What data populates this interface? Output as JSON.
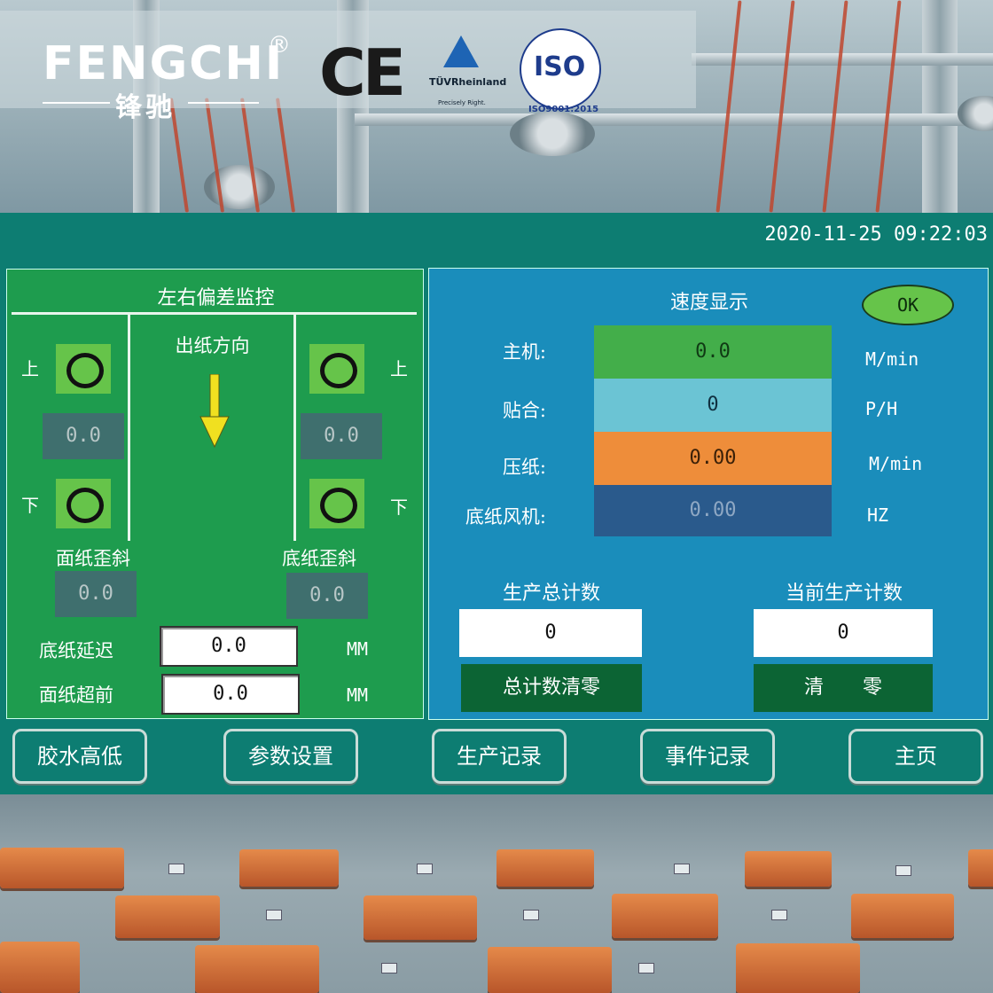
{
  "brand": {
    "name_en": "FENGCHI",
    "registered": "®",
    "name_cn": "锋驰",
    "ce": "CE",
    "tuv_name": "TÜVRheinland",
    "tuv_tagline": "Precisely Right.",
    "iso_mark": "ISO",
    "iso_standard": "ISO9001:2015"
  },
  "header": {
    "datetime": "2020-11-25 09:22:03"
  },
  "deviation_panel": {
    "title": "左右偏差监控",
    "direction_label": "出纸方向",
    "left": {
      "upper_label": "上",
      "upper_value": "0.0",
      "lower_label": "下"
    },
    "right": {
      "upper_label": "上",
      "upper_value": "0.0",
      "lower_label": "下"
    },
    "face_skew_label": "面纸歪斜",
    "face_skew_value": "0.0",
    "base_skew_label": "底纸歪斜",
    "base_skew_value": "0.0",
    "base_delay_label": "底纸延迟",
    "base_delay_value": "0.0",
    "base_delay_unit": "MM",
    "face_advance_label": "面纸超前",
    "face_advance_value": "0.0",
    "face_advance_unit": "MM",
    "colors": {
      "panel": "#1e9c4e",
      "indicator": "#66c44a",
      "arrow": "#f0e020"
    }
  },
  "speed_panel": {
    "title": "速度显示",
    "ok_label": "OK",
    "rows": [
      {
        "label": "主机:",
        "value": "0.0",
        "unit": "M/min",
        "color": "#43ae4a"
      },
      {
        "label": "贴合:",
        "value": "0",
        "unit": "P/H",
        "color": "#6bc4d4"
      },
      {
        "label": "压纸:",
        "value": "0.00",
        "unit": "M/min",
        "color": "#ee8d3a"
      },
      {
        "label": "底纸风机:",
        "value": "0.00",
        "unit": "HZ",
        "color": "#2a5a8c"
      }
    ],
    "total_count_label": "生产总计数",
    "total_count_value": "0",
    "current_count_label": "当前生产计数",
    "current_count_value": "0",
    "clear_total_label": "总计数清零",
    "clear_label": "清　　零",
    "colors": {
      "panel": "#1a8dbb",
      "clear_button": "#0c6434"
    }
  },
  "nav": [
    {
      "label": "胶水高低"
    },
    {
      "label": "参数设置"
    },
    {
      "label": "生产记录"
    },
    {
      "label": "事件记录"
    },
    {
      "label": "主页"
    }
  ],
  "theme": {
    "hmi_background": "#0d7d72"
  }
}
